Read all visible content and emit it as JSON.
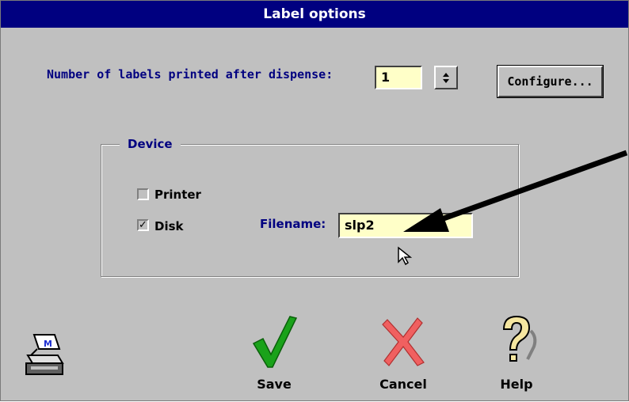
{
  "window": {
    "title": "Label options"
  },
  "count": {
    "label": "Number of labels printed after dispense:",
    "value": "1"
  },
  "configure": {
    "label": "Configure..."
  },
  "device": {
    "group_title": "Device",
    "printer": {
      "label": "Printer",
      "checked": false
    },
    "disk": {
      "label": "Disk",
      "checked": true
    },
    "filename_label": "Filename:",
    "filename_value": "slp2"
  },
  "actions": {
    "save": "Save",
    "cancel": "Cancel",
    "help": "Help"
  },
  "colors": {
    "title_bar": "#000080",
    "face": "#c0c0c0",
    "field": "#ffffc8",
    "label_blue": "#000080",
    "annotation_arrow": "#000000"
  },
  "icons": [
    "spinner-icon",
    "checkmark-icon",
    "x-icon",
    "question-icon",
    "printer-icon",
    "mouse-cursor-icon"
  ]
}
